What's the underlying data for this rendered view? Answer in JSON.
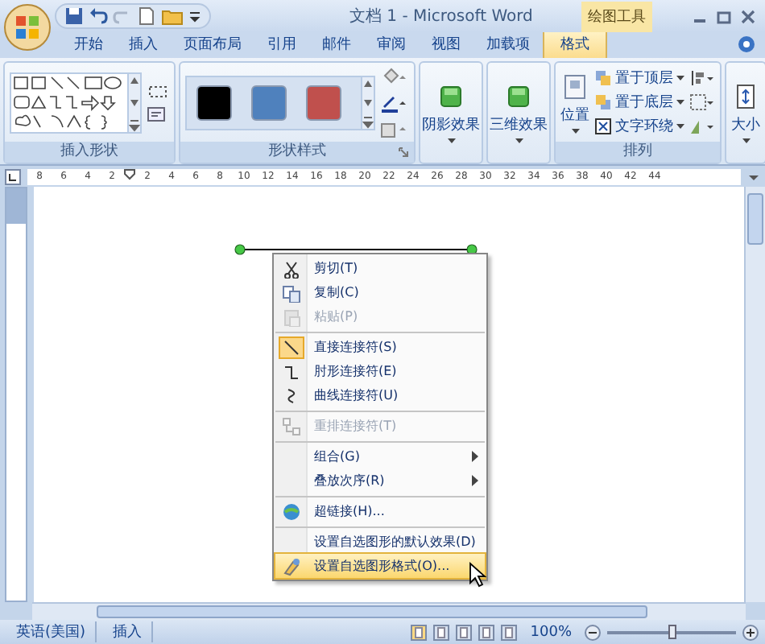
{
  "window": {
    "title": "文档 1 - Microsoft Word",
    "context_tab_group": "绘图工具"
  },
  "tabs": [
    {
      "label": "开始",
      "selected": false
    },
    {
      "label": "插入",
      "selected": false
    },
    {
      "label": "页面布局",
      "selected": false
    },
    {
      "label": "引用",
      "selected": false
    },
    {
      "label": "邮件",
      "selected": false
    },
    {
      "label": "审阅",
      "selected": false
    },
    {
      "label": "视图",
      "selected": false
    },
    {
      "label": "加载项",
      "selected": false
    },
    {
      "label": "格式",
      "selected": true
    }
  ],
  "ribbon": {
    "groups": [
      {
        "kind": "shapes",
        "label": "插入形状"
      },
      {
        "kind": "styles",
        "label": "形状样式",
        "swatches": [
          {
            "color": "#000000"
          },
          {
            "color": "#4f81bd"
          },
          {
            "color": "#c0504d"
          }
        ]
      },
      {
        "kind": "effects",
        "buttons": [
          "阴影效果",
          "三维效果"
        ]
      },
      {
        "kind": "arrange",
        "label": "排列",
        "position": "位置",
        "items": [
          "置于顶层",
          "置于底层",
          "文字环绕"
        ]
      },
      {
        "kind": "size",
        "buttons": [
          "大小"
        ]
      }
    ]
  },
  "ruler": {
    "numbers": [
      "8",
      "6",
      "4",
      "2",
      "2",
      "4",
      "6",
      "8",
      "10",
      "12",
      "14",
      "16",
      "18",
      "20",
      "22",
      "24",
      "26",
      "28",
      "30",
      "32",
      "34",
      "36",
      "38",
      "40",
      "42",
      "44"
    ]
  },
  "context_menu": {
    "items": [
      {
        "label": "剪切(T)",
        "disabled": false,
        "checked": false,
        "selected": false,
        "submenu": false,
        "separator_before": false
      },
      {
        "label": "复制(C)",
        "disabled": false,
        "checked": false,
        "selected": false,
        "submenu": false,
        "separator_before": false
      },
      {
        "label": "粘贴(P)",
        "disabled": true,
        "checked": false,
        "selected": false,
        "submenu": false,
        "separator_before": false
      },
      {
        "label": "直接连接符(S)",
        "disabled": false,
        "checked": true,
        "selected": false,
        "submenu": false,
        "separator_before": true
      },
      {
        "label": "肘形连接符(E)",
        "disabled": false,
        "checked": false,
        "selected": false,
        "submenu": false,
        "separator_before": false
      },
      {
        "label": "曲线连接符(U)",
        "disabled": false,
        "checked": false,
        "selected": false,
        "submenu": false,
        "separator_before": false
      },
      {
        "label": "重排连接符(T)",
        "disabled": true,
        "checked": false,
        "selected": false,
        "submenu": false,
        "separator_before": true
      },
      {
        "label": "组合(G)",
        "disabled": false,
        "checked": false,
        "selected": false,
        "submenu": true,
        "separator_before": true
      },
      {
        "label": "叠放次序(R)",
        "disabled": false,
        "checked": false,
        "selected": false,
        "submenu": true,
        "separator_before": false
      },
      {
        "label": "超链接(H)...",
        "disabled": false,
        "checked": false,
        "selected": false,
        "submenu": false,
        "separator_before": true
      },
      {
        "label": "设置自选图形的默认效果(D)",
        "disabled": false,
        "checked": false,
        "selected": false,
        "submenu": false,
        "separator_before": true
      },
      {
        "label": "设置自选图形格式(O)...",
        "disabled": false,
        "checked": false,
        "selected": true,
        "submenu": false,
        "separator_before": false
      }
    ]
  },
  "status_bar": {
    "language": "英语(美国)",
    "mode": "插入",
    "zoom": "100%",
    "zoom_slider": {
      "level": 0.5
    }
  }
}
